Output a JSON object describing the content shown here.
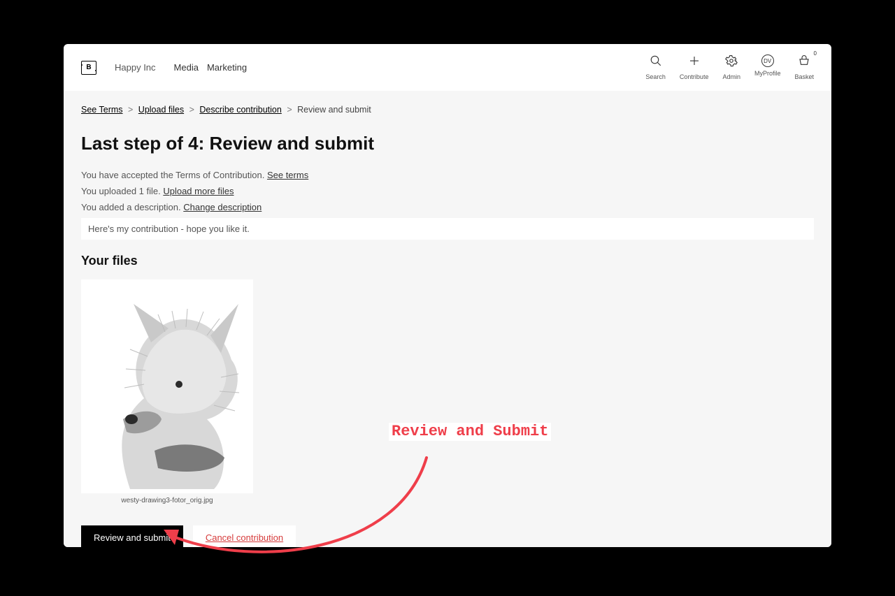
{
  "header": {
    "org_name": "Happy Inc",
    "tabs": [
      "Media",
      "Marketing"
    ],
    "icons": {
      "search": "Search",
      "contribute": "Contribute",
      "admin": "Admin",
      "profile_initials": "DV",
      "profile": "MyProfile",
      "basket": "Basket",
      "basket_count": "0"
    }
  },
  "breadcrumb": {
    "items": [
      {
        "label": "See Terms"
      },
      {
        "label": "Upload files"
      },
      {
        "label": "Describe contribution"
      }
    ],
    "current": "Review and submit",
    "sep": ">"
  },
  "page": {
    "title": "Last step of 4: Review and submit",
    "line1_text": "You have accepted the Terms of Contribution. ",
    "line1_link": "See terms",
    "line2_text": "You uploaded 1 file. ",
    "line2_link": "Upload more files",
    "line3_text": "You added a description. ",
    "line3_link": "Change description",
    "description_value": "Here's my contribution - hope you like it.",
    "files_heading": "Your files",
    "files": [
      {
        "filename": "westy-drawing3-fotor_orig.jpg"
      }
    ],
    "primary_button": "Review and submit",
    "cancel_button": "Cancel contribution"
  },
  "annotation": {
    "label": "Review and Submit"
  }
}
